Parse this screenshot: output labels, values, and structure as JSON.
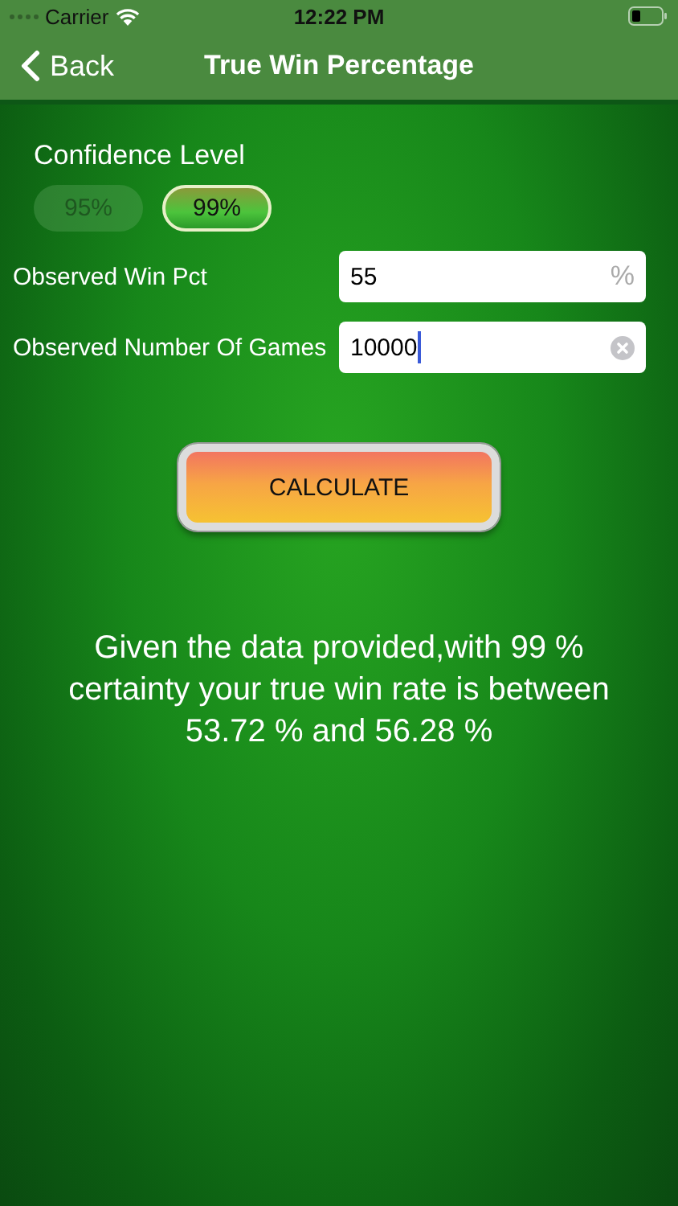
{
  "status_bar": {
    "carrier": "Carrier",
    "time": "12:22 PM"
  },
  "nav": {
    "back": "Back",
    "title": "True Win Percentage"
  },
  "confidence": {
    "label": "Confidence Level",
    "options": [
      {
        "label": "95%",
        "selected": false
      },
      {
        "label": "99%",
        "selected": true
      }
    ]
  },
  "fields": [
    {
      "label": "Observed Win Pct",
      "value": "55",
      "suffix": "%",
      "focused": false
    },
    {
      "label": "Observed Number Of Games",
      "value": "10000",
      "focused": true
    }
  ],
  "button": "CALCULATE",
  "result": "Given the data provided,with 99 % certainty your true win rate is between 53.72 % and 56.28 %"
}
